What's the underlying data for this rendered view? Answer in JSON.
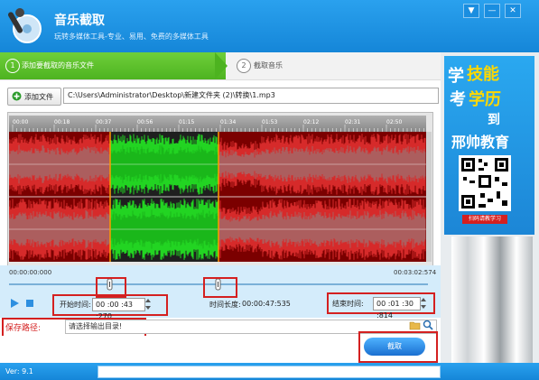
{
  "app": {
    "title": "音乐截取",
    "subtitle": "玩转多媒体工具-专业、易用、免费的多媒体工具",
    "window_buttons": [
      "▼",
      "—",
      "✕"
    ]
  },
  "steps": [
    {
      "number": "1",
      "label": "添加要截取的音乐文件"
    },
    {
      "number": "2",
      "label": "截取音乐"
    }
  ],
  "toolbar": {
    "add_file_label": "添加文件",
    "file_path": "C:\\Users\\Administrator\\Desktop\\新建文件夹 (2)\\转换\\1.mp3"
  },
  "timeline": {
    "ticks": [
      "00:00",
      "00:18",
      "00:37",
      "00:56",
      "01:15",
      "01:34",
      "01:53",
      "02:12",
      "02:31",
      "02:50"
    ]
  },
  "selection": {
    "position_start": "00:00:00:000",
    "position_end": "00:03:02:574",
    "start_label": "开始时间:",
    "start_value": "00 :00 :43 :270",
    "duration_label": "时间长度:",
    "duration_value": "00:00:47:535",
    "end_label": "结束时间:",
    "end_value": "00 :01 :30 :814"
  },
  "save": {
    "label": "保存路径:",
    "placeholder_text": "请选择输出目录!"
  },
  "actions": {
    "cut_label": "截取"
  },
  "status": {
    "version": "Ver: 9.1"
  },
  "ad": {
    "line1_a": "学",
    "line1_b": "技能",
    "line2_a": "考",
    "line2_b": "学历",
    "line3": "到",
    "brand": "邢帅教育",
    "qr_caption": "扫码请教学习"
  },
  "colors": {
    "accent_blue": "#1a8ee0",
    "step_green": "#4db320",
    "wave_bg": "#7b0000",
    "wave_red": "#d62a2a",
    "wave_selected": "#22d422",
    "highlight_red": "#d42020"
  }
}
